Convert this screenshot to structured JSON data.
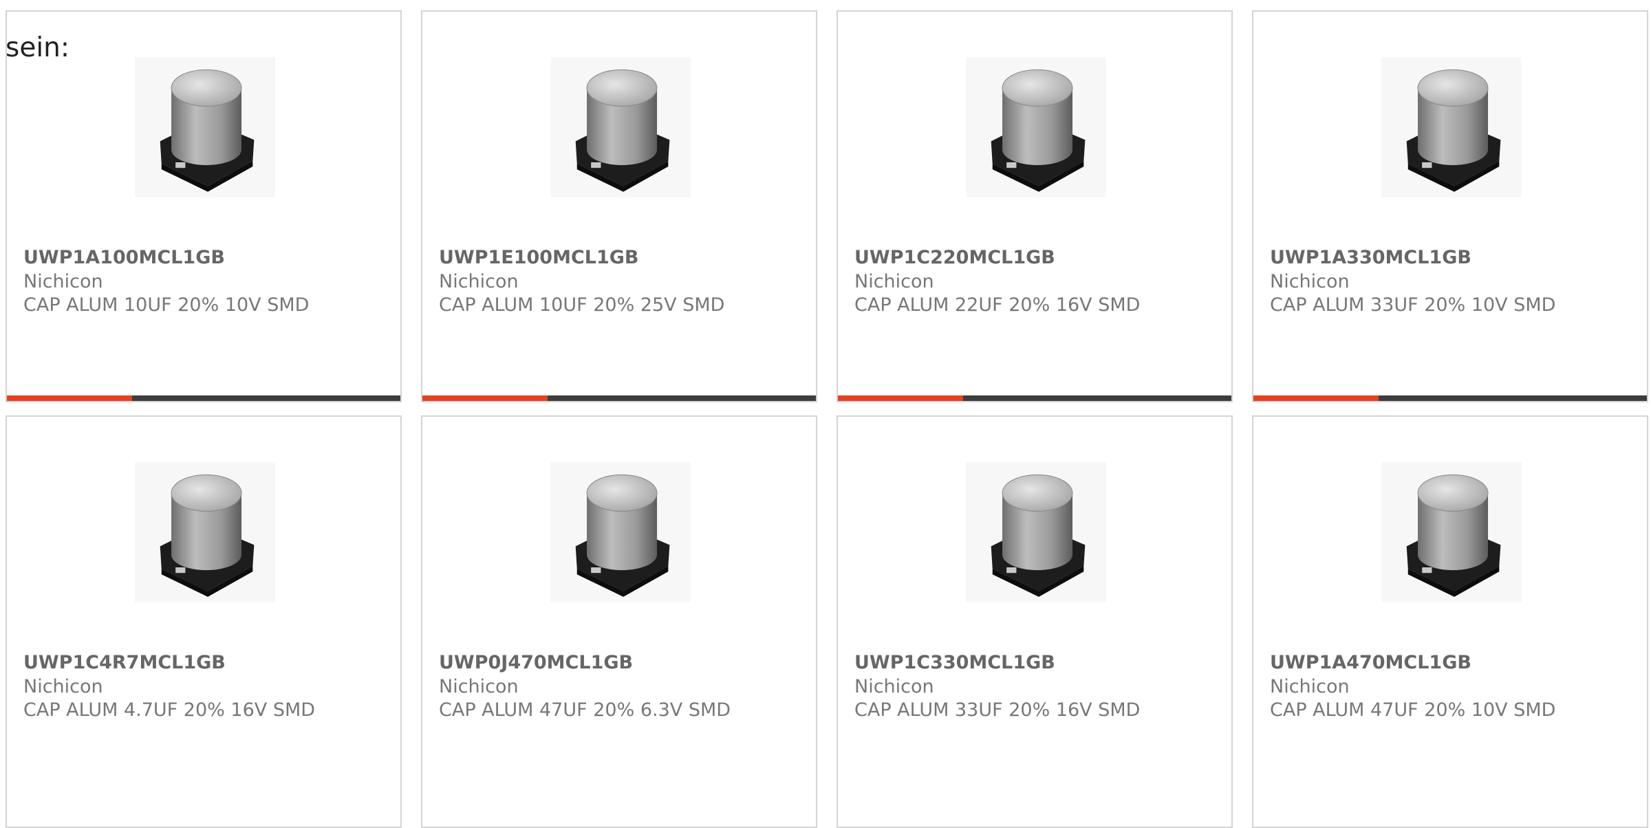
{
  "intro_text": "sein:",
  "colors": {
    "accent": "#e6411d",
    "bar": "#3d3d3d",
    "border": "#d4d4d4",
    "text": "#666666"
  },
  "products": [
    {
      "part_number": "UWP1A100MCL1GB",
      "manufacturer": "Nichicon",
      "description": "CAP ALUM 10UF 20% 10V SMD",
      "image": "smd-electrolytic-capacitor-image"
    },
    {
      "part_number": "UWP1E100MCL1GB",
      "manufacturer": "Nichicon",
      "description": "CAP ALUM 10UF 20% 25V SMD",
      "image": "smd-electrolytic-capacitor-image"
    },
    {
      "part_number": "UWP1C220MCL1GB",
      "manufacturer": "Nichicon",
      "description": "CAP ALUM 22UF 20% 16V SMD",
      "image": "smd-electrolytic-capacitor-image"
    },
    {
      "part_number": "UWP1A330MCL1GB",
      "manufacturer": "Nichicon",
      "description": "CAP ALUM 33UF 20% 10V SMD",
      "image": "smd-electrolytic-capacitor-image"
    },
    {
      "part_number": "UWP1C4R7MCL1GB",
      "manufacturer": "Nichicon",
      "description": "CAP ALUM 4.7UF 20% 16V SMD",
      "image": "smd-electrolytic-capacitor-image"
    },
    {
      "part_number": "UWP0J470MCL1GB",
      "manufacturer": "Nichicon",
      "description": "CAP ALUM 47UF 20% 6.3V SMD",
      "image": "smd-electrolytic-capacitor-image"
    },
    {
      "part_number": "UWP1C330MCL1GB",
      "manufacturer": "Nichicon",
      "description": "CAP ALUM 33UF 20% 16V SMD",
      "image": "smd-electrolytic-capacitor-image"
    },
    {
      "part_number": "UWP1A470MCL1GB",
      "manufacturer": "Nichicon",
      "description": "CAP ALUM 47UF 20% 10V SMD",
      "image": "smd-electrolytic-capacitor-image"
    }
  ]
}
